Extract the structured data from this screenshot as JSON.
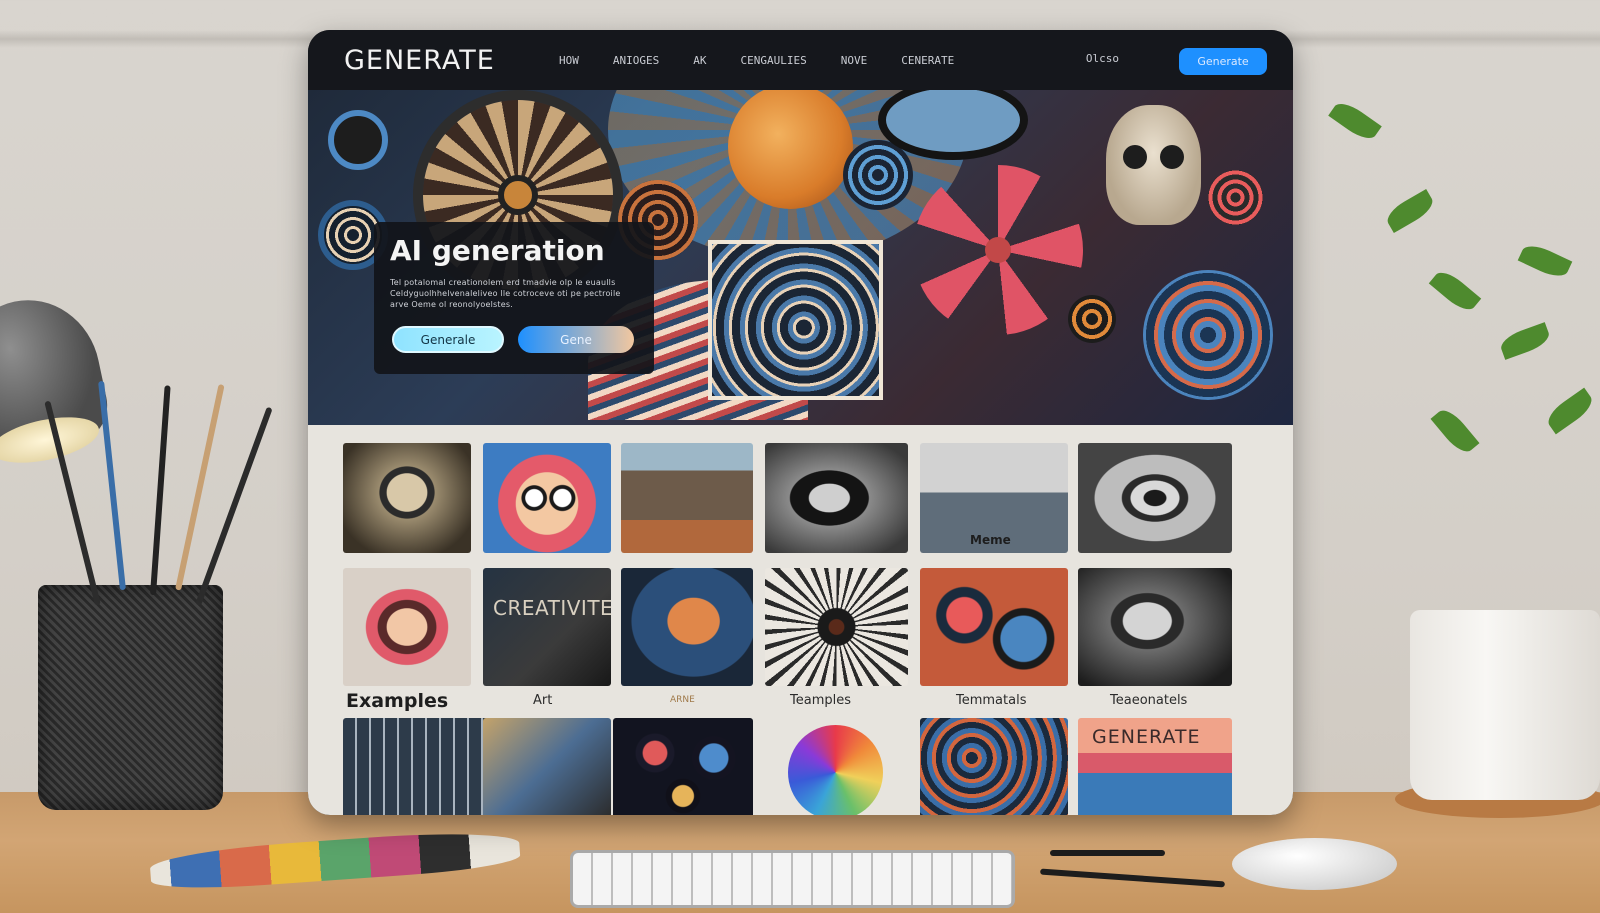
{
  "app": {
    "logo": "GENERATE"
  },
  "nav": {
    "items": [
      "HOW",
      "ANIOGES",
      "AK",
      "CENGAULIES",
      "NOVE",
      "CENERATE"
    ],
    "trailing": "Olcso",
    "cta": "Generate"
  },
  "hero": {
    "title": "AI generation",
    "description": "Tel potalomal creationolem erd tmadvie olp le euaulls Celdyguolhhelvenaleliveo lle cotroceve oti pe pectroile arve Oeme ol reonolyoelstes.",
    "primary_button": "Generale",
    "secondary_button": "Gene"
  },
  "gallery": {
    "labels": {
      "memes": "Meme",
      "examples": "Examples",
      "art": "Art",
      "small": "ARNE",
      "teamples": "Teamples",
      "tempiatels": "Temmatals",
      "teaeonatels": "Teaeonatels"
    },
    "creative_text": "CREATIVITE",
    "generate_text": "GENERATE"
  },
  "colors": {
    "accent": "#1e90ff",
    "nav_bg": "#15171c",
    "gallery_bg": "#e7e4de"
  }
}
